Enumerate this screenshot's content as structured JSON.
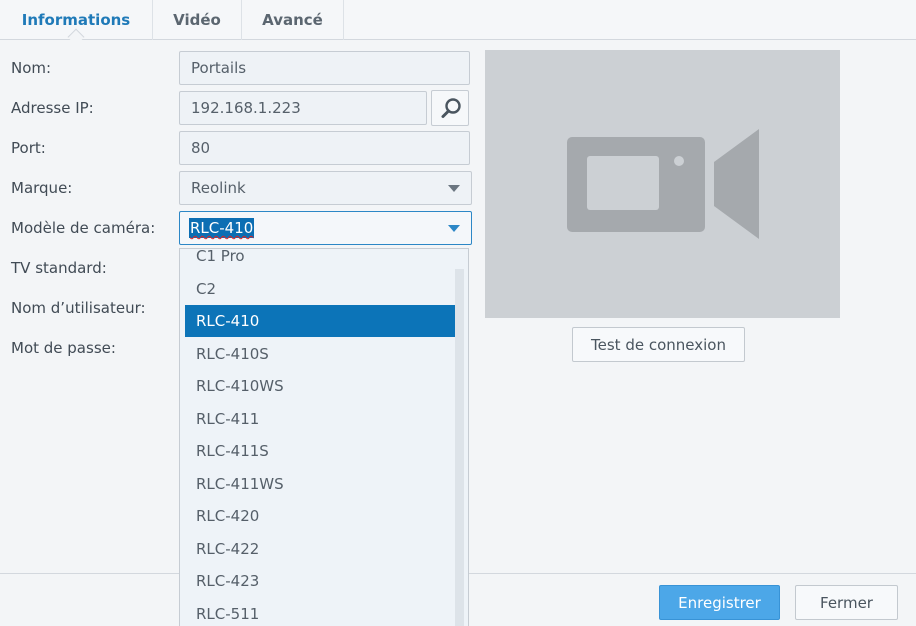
{
  "tabs": [
    {
      "label": "Informations",
      "active": true
    },
    {
      "label": "Vidéo",
      "active": false
    },
    {
      "label": "Avancé",
      "active": false
    }
  ],
  "form": {
    "name_label": "Nom:",
    "name_value": "Portails",
    "ip_label": "Adresse IP:",
    "ip_value": "192.168.1.223",
    "port_label": "Port:",
    "port_value": "80",
    "brand_label": "Marque:",
    "brand_value": "Reolink",
    "model_label": "Modèle de caméra:",
    "model_value": "RLC-410",
    "tv_label": "TV standard:",
    "user_label": "Nom d’utilisateur:",
    "password_label": "Mot de passe:"
  },
  "dropdown": {
    "items": [
      "C1 Pro",
      "C2",
      "RLC-410",
      "RLC-410S",
      "RLC-410WS",
      "RLC-411",
      "RLC-411S",
      "RLC-411WS",
      "RLC-420",
      "RLC-422",
      "RLC-423",
      "RLC-511"
    ],
    "selected": "RLC-410"
  },
  "preview": {
    "icon": "video-camera-icon",
    "test_button": "Test de connexion"
  },
  "footer": {
    "save_label": "Enregistrer",
    "close_label": "Fermer"
  },
  "colors": {
    "accent": "#1f7ab8",
    "selection": "#0c74b8",
    "primary_button": "#4ca7e8"
  }
}
